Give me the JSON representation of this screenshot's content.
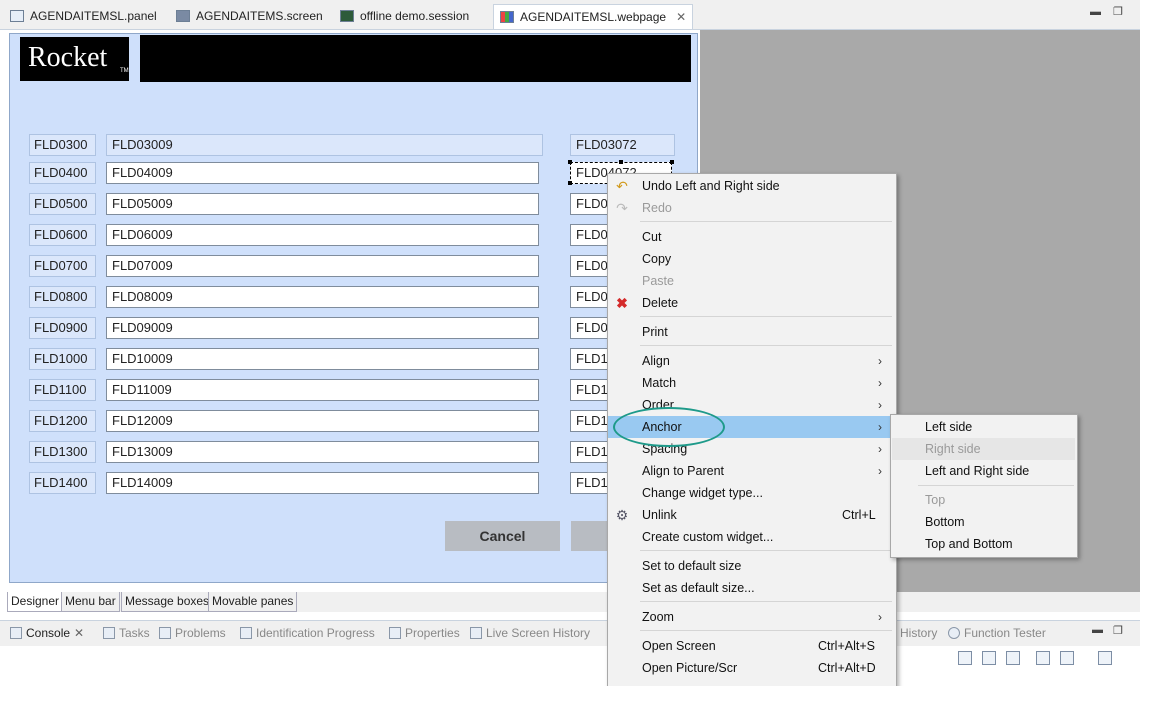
{
  "editor_tabs": [
    {
      "label": "AGENDAITEMSL.panel",
      "icon": "panel-file-icon"
    },
    {
      "label": "AGENDAITEMS.screen",
      "icon": "screen-file-icon"
    },
    {
      "label": "offline demo.session",
      "icon": "session-file-icon"
    },
    {
      "label": "AGENDAITEMSL.webpage",
      "icon": "webpage-file-icon",
      "active": true
    }
  ],
  "logo": {
    "text": "Rocket",
    "tm": "TM"
  },
  "form_rows": [
    {
      "label": "FLD0300",
      "field": "FLD03009",
      "right": "FLD03072"
    },
    {
      "label": "FLD0400",
      "field": "FLD04009",
      "right": "FLD04072"
    },
    {
      "label": "FLD0500",
      "field": "FLD05009",
      "right": "FLD0"
    },
    {
      "label": "FLD0600",
      "field": "FLD06009",
      "right": "FLD0"
    },
    {
      "label": "FLD0700",
      "field": "FLD07009",
      "right": "FLD0"
    },
    {
      "label": "FLD0800",
      "field": "FLD08009",
      "right": "FLD0"
    },
    {
      "label": "FLD0900",
      "field": "FLD09009",
      "right": "FLD0"
    },
    {
      "label": "FLD1000",
      "field": "FLD10009",
      "right": "FLD1"
    },
    {
      "label": "FLD1100",
      "field": "FLD11009",
      "right": "FLD1"
    },
    {
      "label": "FLD1200",
      "field": "FLD12009",
      "right": "FLD1"
    },
    {
      "label": "FLD1300",
      "field": "FLD13009",
      "right": "FLD1"
    },
    {
      "label": "FLD1400",
      "field": "FLD14009",
      "right": "FLD1"
    }
  ],
  "buttons": {
    "cancel": "Cancel"
  },
  "designer_tabs": [
    "Designer",
    "Menu bar",
    "Message boxes",
    "Movable panes"
  ],
  "view_tabs": [
    {
      "label": "Console",
      "active": true
    },
    {
      "label": "Tasks"
    },
    {
      "label": "Problems"
    },
    {
      "label": "Identification Progress"
    },
    {
      "label": "Properties"
    },
    {
      "label": "Live Screen History"
    },
    {
      "label": "History"
    },
    {
      "label": "Function Tester"
    }
  ],
  "context_menu": {
    "undo": "Undo Left and Right side",
    "redo": "Redo",
    "cut": "Cut",
    "copy": "Copy",
    "paste": "Paste",
    "delete": "Delete",
    "print": "Print",
    "align": "Align",
    "match": "Match",
    "order": "Order",
    "anchor": "Anchor",
    "spacing": "Spacing",
    "align_to_parent": "Align to Parent",
    "change_widget_type": "Change widget type...",
    "unlink": "Unlink",
    "unlink_shortcut": "Ctrl+L",
    "create_custom_widget": "Create custom widget...",
    "set_default_size": "Set to default size",
    "set_as_default_size": "Set as default size...",
    "zoom": "Zoom",
    "open_screen": "Open Screen",
    "open_screen_shortcut": "Ctrl+Alt+S",
    "open_picture": "Open Picture/Scr",
    "open_picture_shortcut": "Ctrl+Alt+D"
  },
  "anchor_submenu": {
    "left_side": "Left side",
    "right_side": "Right side",
    "left_and_right_side": "Left and Right side",
    "top": "Top",
    "bottom": "Bottom",
    "top_and_bottom": "Top and Bottom"
  }
}
